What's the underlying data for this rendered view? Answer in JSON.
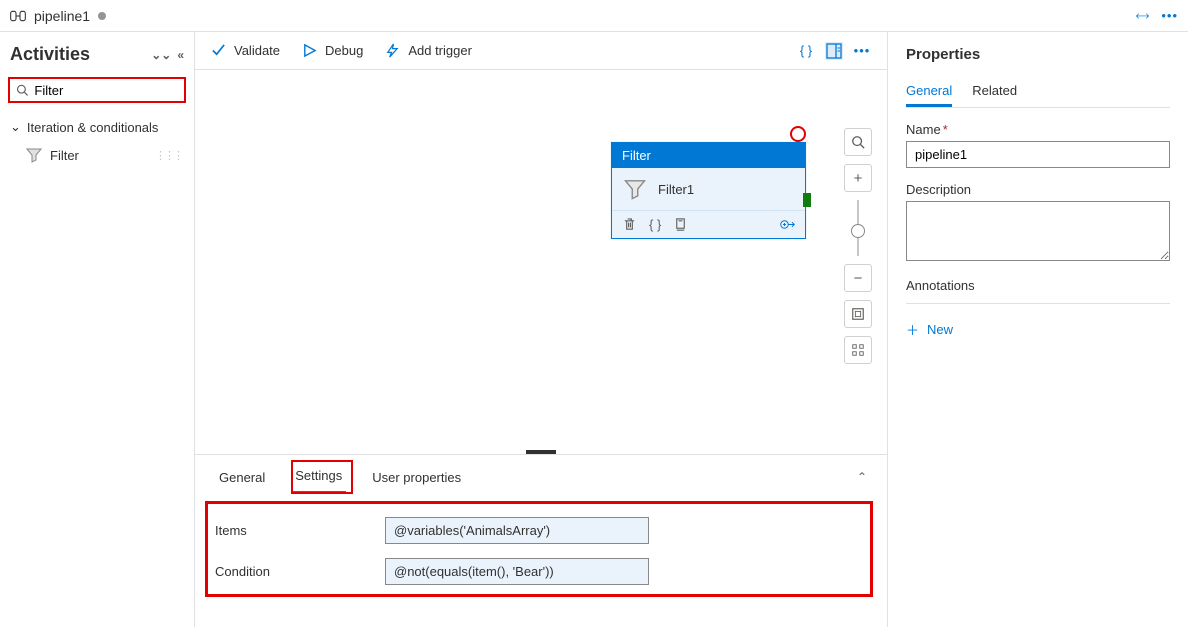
{
  "tab": {
    "name": "pipeline1"
  },
  "sidebar": {
    "title": "Activities",
    "search_value": "Filter",
    "group": "Iteration & conditionals",
    "item": "Filter"
  },
  "toolbar": {
    "validate": "Validate",
    "debug": "Debug",
    "add_trigger": "Add trigger"
  },
  "node": {
    "type": "Filter",
    "name": "Filter1"
  },
  "bottom": {
    "tabs": {
      "general": "General",
      "settings": "Settings",
      "user_props": "User properties"
    },
    "items_label": "Items",
    "items_value": "@variables('AnimalsArray')",
    "condition_label": "Condition",
    "condition_value": "@not(equals(item(), 'Bear'))"
  },
  "properties": {
    "title": "Properties",
    "tabs": {
      "general": "General",
      "related": "Related"
    },
    "name_label": "Name",
    "name_value": "pipeline1",
    "description_label": "Description",
    "description_value": "",
    "annotations_label": "Annotations",
    "new_label": "New"
  }
}
